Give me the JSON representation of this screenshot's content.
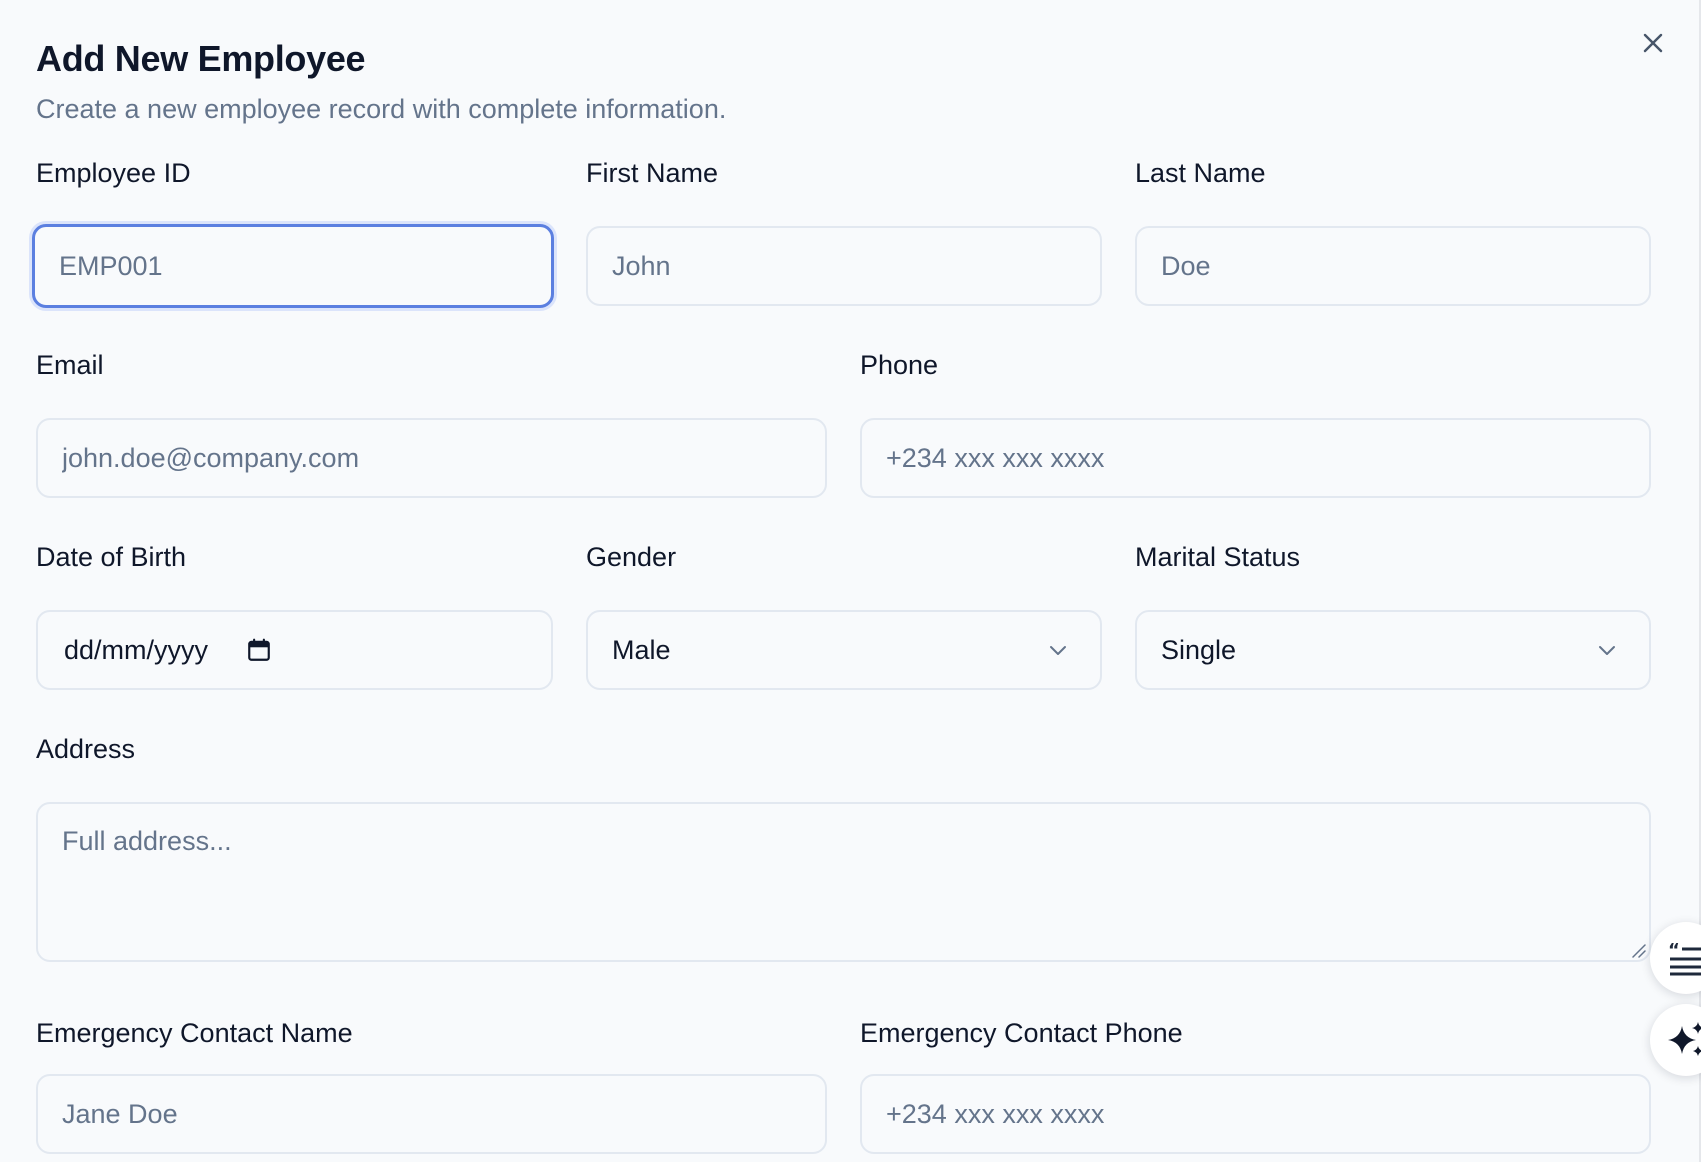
{
  "dialog": {
    "title": "Add New Employee",
    "subtitle": "Create a new employee record with complete information."
  },
  "fields": {
    "employee_id": {
      "label": "Employee ID",
      "placeholder": "EMP001",
      "value": ""
    },
    "first_name": {
      "label": "First Name",
      "placeholder": "John",
      "value": ""
    },
    "last_name": {
      "label": "Last Name",
      "placeholder": "Doe",
      "value": ""
    },
    "email": {
      "label": "Email",
      "placeholder": "john.doe@company.com",
      "value": ""
    },
    "phone": {
      "label": "Phone",
      "placeholder": "+234 xxx xxx xxxx",
      "value": ""
    },
    "date_of_birth": {
      "label": "Date of Birth",
      "display": "dd/mm/yyyy"
    },
    "gender": {
      "label": "Gender",
      "selected": "Male"
    },
    "marital_status": {
      "label": "Marital Status",
      "selected": "Single"
    },
    "address": {
      "label": "Address",
      "placeholder": "Full address..."
    },
    "emergency_contact_name": {
      "label": "Emergency Contact Name",
      "placeholder": "Jane Doe",
      "value": ""
    },
    "emergency_contact_phone": {
      "label": "Emergency Contact Phone",
      "placeholder": "+234 xxx xxx xxxx",
      "value": ""
    }
  },
  "icons": {
    "close": "close-icon",
    "calendar": "calendar-icon",
    "chevron": "chevron-down-icon",
    "quote": "quote-list-icon",
    "sparkle": "sparkle-icon"
  },
  "colors": {
    "background": "#f8fafc",
    "text_primary": "#0f172a",
    "text_muted": "#64748b",
    "border": "#e2e8f0",
    "focus_ring": "#5b7fe0"
  }
}
